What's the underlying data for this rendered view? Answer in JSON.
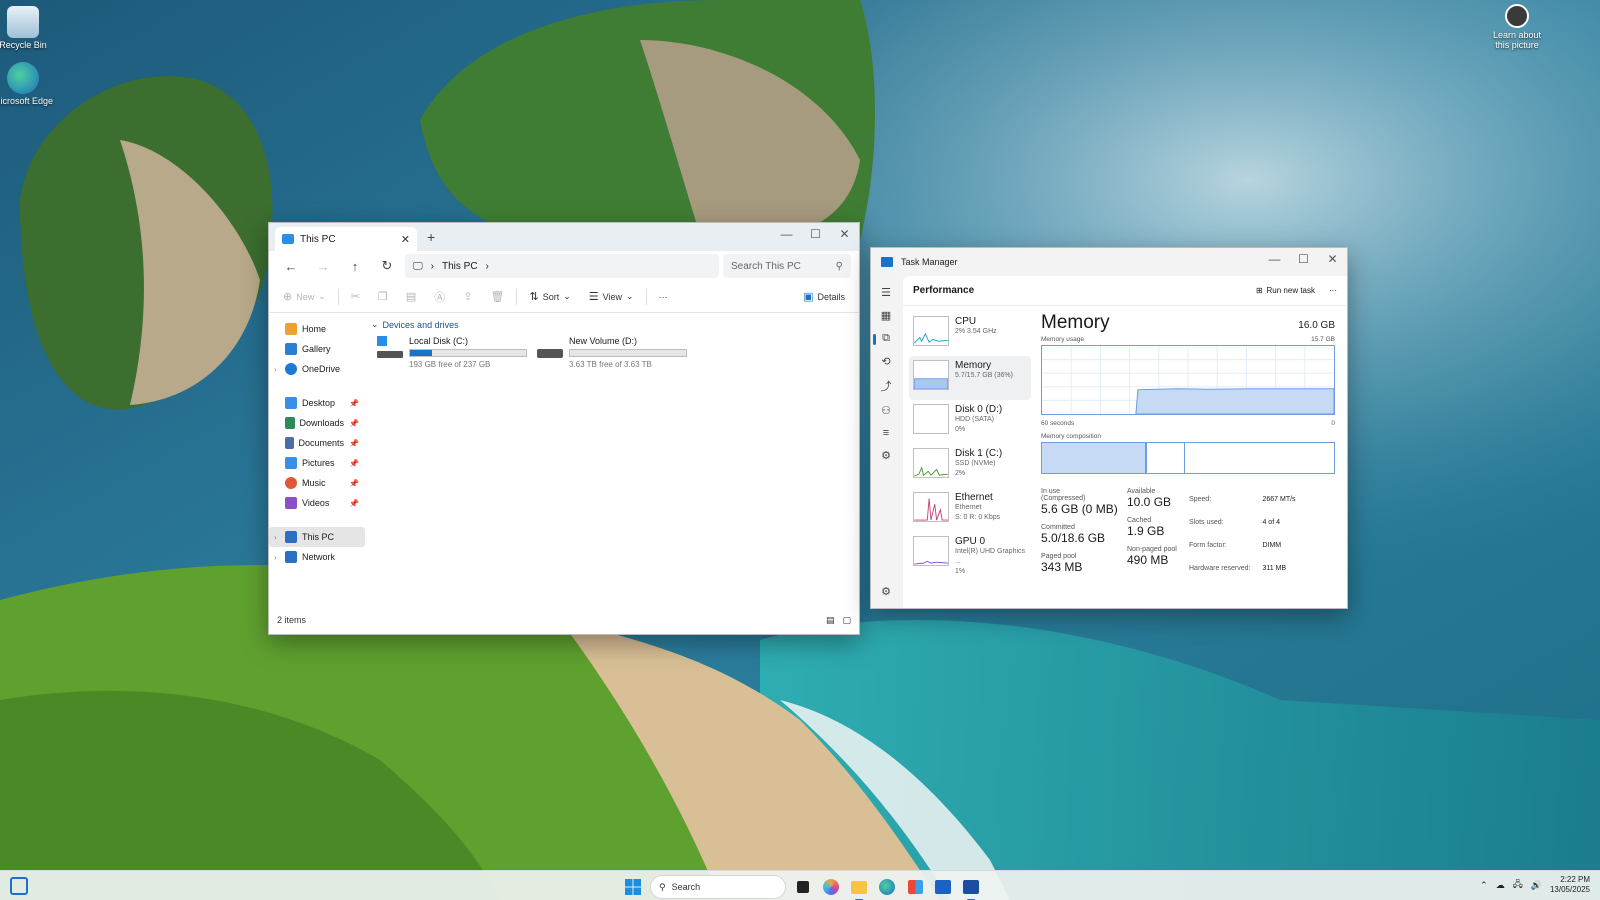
{
  "desktop": {
    "icons": [
      {
        "label": "Recycle Bin"
      },
      {
        "label": "Microsoft Edge"
      },
      {
        "label": "Learn about this picture"
      }
    ]
  },
  "explorer": {
    "tab_title": "This PC",
    "nav": {
      "address_segment": "This PC",
      "search_placeholder": "Search This PC"
    },
    "commands": {
      "new": "New",
      "sort": "Sort",
      "view": "View",
      "more": "···",
      "details": "Details"
    },
    "sidebar": {
      "top": [
        {
          "label": "Home",
          "color": "#f0a030"
        },
        {
          "label": "Gallery",
          "color": "#2a7fd4"
        },
        {
          "label": "OneDrive",
          "color": "#1f78d1"
        }
      ],
      "pinned": [
        {
          "label": "Desktop",
          "color": "#3a8ee6"
        },
        {
          "label": "Downloads",
          "color": "#2e8b57"
        },
        {
          "label": "Documents",
          "color": "#4a6fa5"
        },
        {
          "label": "Pictures",
          "color": "#3a8ee6"
        },
        {
          "label": "Music",
          "color": "#e0573a"
        },
        {
          "label": "Videos",
          "color": "#8a4fc9"
        }
      ],
      "bottom": [
        {
          "label": "This PC",
          "color": "#2a6fc4"
        },
        {
          "label": "Network",
          "color": "#2a6fc4"
        }
      ]
    },
    "group_label": "Devices and drives",
    "drives": [
      {
        "name": "Local Disk (C:)",
        "free": "193 GB free of 237 GB",
        "used_fraction": 0.19
      },
      {
        "name": "New Volume (D:)",
        "free": "3.63 TB free of 3.63 TB",
        "used_fraction": 0.0
      }
    ],
    "status": "2 items"
  },
  "taskmgr": {
    "title": "Task Manager",
    "section": "Performance",
    "run_new_task": "Run new task",
    "more": "···",
    "items": [
      {
        "name": "CPU",
        "sub1": "2%  3.54 GHz",
        "sub2": "",
        "sub3": ""
      },
      {
        "name": "Memory",
        "sub1": "5.7/15.7 GB (36%)",
        "sub2": "",
        "sub3": ""
      },
      {
        "name": "Disk 0 (D:)",
        "sub1": "HDD (SATA)",
        "sub2": "0%",
        "sub3": ""
      },
      {
        "name": "Disk 1 (C:)",
        "sub1": "SSD (NVMe)",
        "sub2": "2%",
        "sub3": ""
      },
      {
        "name": "Ethernet",
        "sub1": "Ethernet",
        "sub2": "S: 0 R: 0 Kbps",
        "sub3": ""
      },
      {
        "name": "GPU 0",
        "sub1": "Intel(R) UHD Graphics ...",
        "sub2": "1%",
        "sub3": ""
      }
    ],
    "memory": {
      "title": "Memory",
      "total": "16.0 GB",
      "usage_label": "Memory usage",
      "usage_max": "15.7 GB",
      "axis_left": "60 seconds",
      "axis_right": "0",
      "composition_label": "Memory composition",
      "in_use_fraction": 0.36,
      "stats": {
        "in_use_label": "In use (Compressed)",
        "in_use_value": "5.6 GB (0 MB)",
        "available_label": "Available",
        "available_value": "10.0 GB",
        "committed_label": "Committed",
        "committed_value": "5.0/18.6 GB",
        "cached_label": "Cached",
        "cached_value": "1.9 GB",
        "paged_label": "Paged pool",
        "paged_value": "343 MB",
        "nonpaged_label": "Non-paged pool",
        "nonpaged_value": "490 MB"
      },
      "spec": [
        {
          "k": "Speed:",
          "v": "2667 MT/s"
        },
        {
          "k": "Slots used:",
          "v": "4 of 4"
        },
        {
          "k": "Form factor:",
          "v": "DIMM"
        },
        {
          "k": "Hardware reserved:",
          "v": "311 MB"
        }
      ]
    }
  },
  "taskbar": {
    "search_placeholder": "Search",
    "time": "2:22 PM",
    "date": "13/05/2025"
  }
}
